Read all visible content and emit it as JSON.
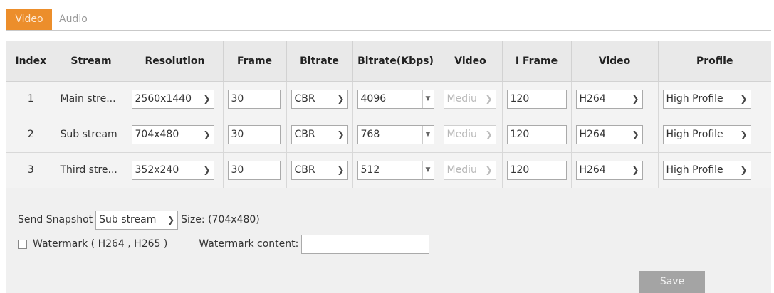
{
  "tabs": [
    {
      "label": "Video"
    },
    {
      "label": "Audio"
    }
  ],
  "table": {
    "headers": [
      "Index",
      "Stream",
      "Resolution",
      "Frame",
      "Bitrate",
      "Bitrate(Kbps)",
      "Video",
      "I Frame",
      "Video",
      "Profile"
    ],
    "rows": [
      {
        "index": "1",
        "stream": "Main stre...",
        "resolution": "2560x1440",
        "frame": "30",
        "bitrate": "CBR",
        "kbps": "4096",
        "quality": "Mediu",
        "iframe": "120",
        "codec": "H264",
        "profile": "High Profile"
      },
      {
        "index": "2",
        "stream": "Sub stream",
        "resolution": "704x480",
        "frame": "30",
        "bitrate": "CBR",
        "kbps": "768",
        "quality": "Mediu",
        "iframe": "120",
        "codec": "H264",
        "profile": "High Profile"
      },
      {
        "index": "3",
        "stream": "Third stre...",
        "resolution": "352x240",
        "frame": "30",
        "bitrate": "CBR",
        "kbps": "512",
        "quality": "Mediu",
        "iframe": "120",
        "codec": "H264",
        "profile": "High Profile"
      }
    ]
  },
  "snapshot": {
    "label": "Send Snapshot",
    "selected": "Sub stream",
    "size_text": "Size: (704x480)"
  },
  "watermark": {
    "label": "Watermark ( H264 , H265 )",
    "content_label": "Watermark content:",
    "content_value": ""
  },
  "save_label": "Save"
}
